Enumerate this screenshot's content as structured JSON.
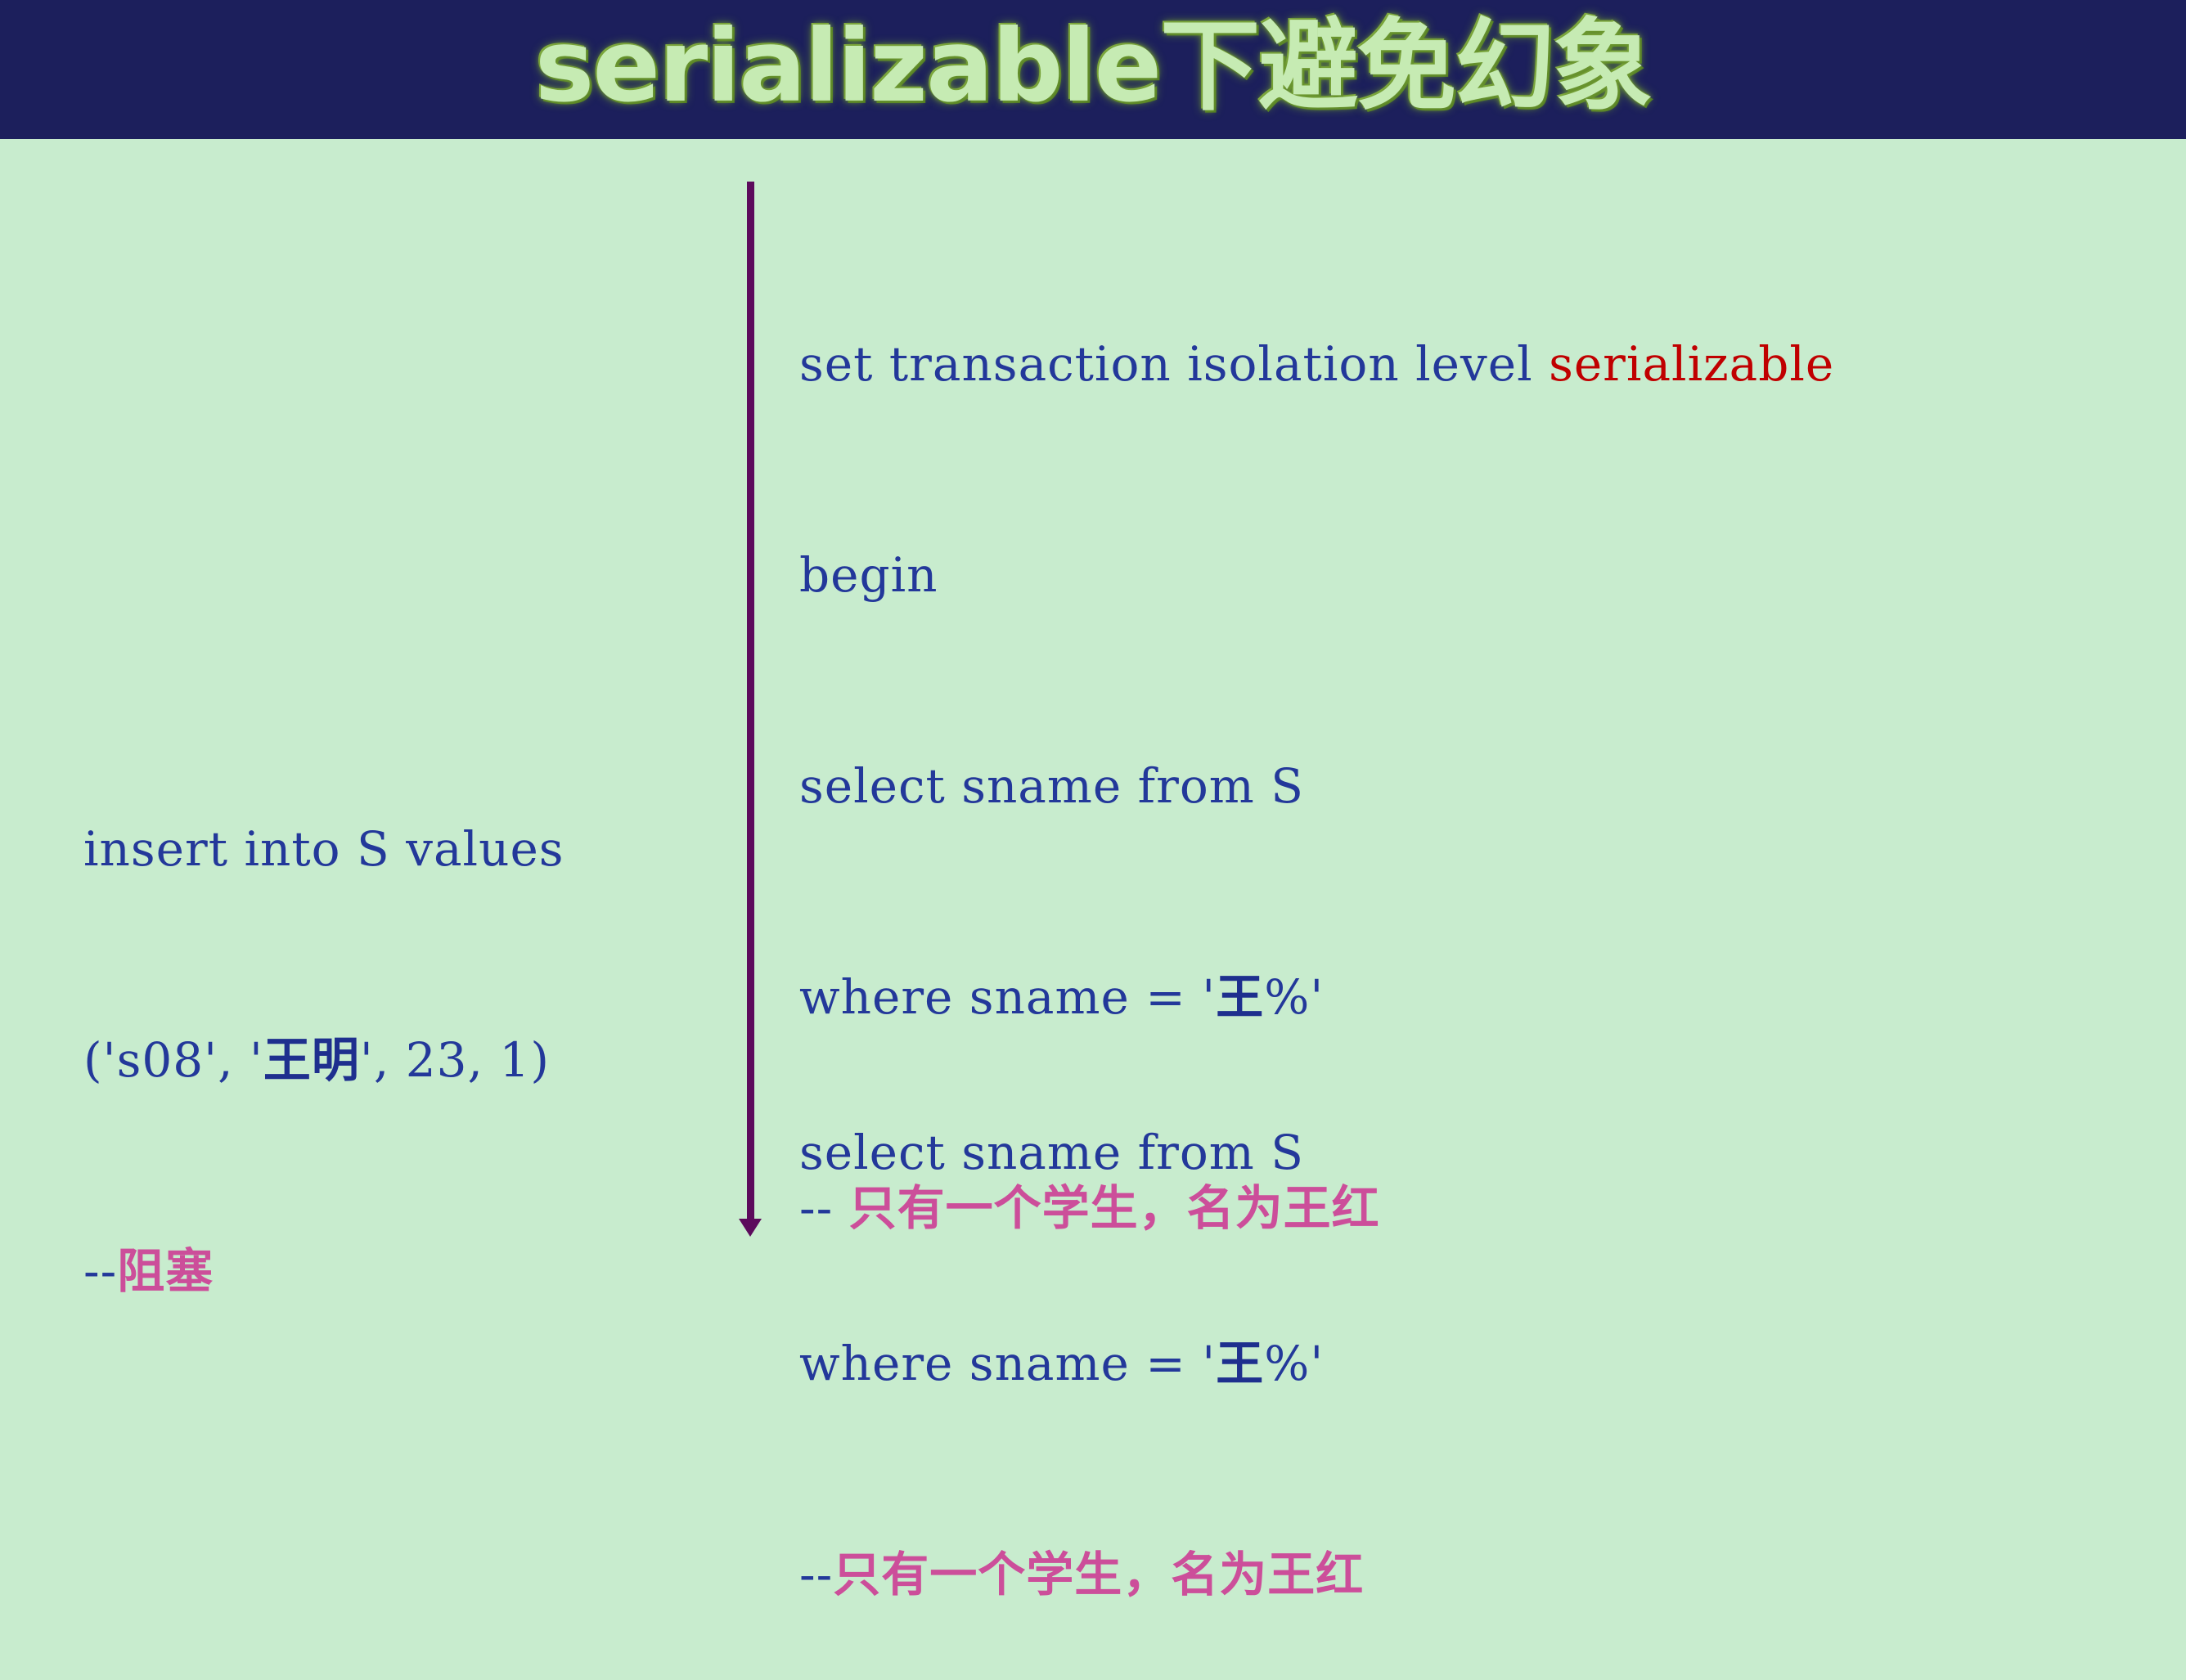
{
  "title": "serializable下避免幻象",
  "colors": {
    "header_bg": "#1c1f5c",
    "page_bg": "#c8ecce",
    "code_blue": "#23389a",
    "keyword_red": "#c00000",
    "comment_pink": "#cc4e9a",
    "timeline": "#5c0b5c"
  },
  "session_b_first": {
    "line1_prefix": "set transaction isolation level ",
    "line1_keyword": "serializable",
    "line2": "begin",
    "line3": "select sname from S",
    "line4_prefix": "where sname = '",
    "line4_cjk": "王",
    "line4_suffix": "%'",
    "line5_dash": "-- ",
    "line5_comment": "只有一个学生，名为王红"
  },
  "session_a": {
    "line1": "insert into S values",
    "line2_a": "('s08', '",
    "line2_cjk": "王明",
    "line2_b": "', 23, 1)",
    "line3_dash": "--",
    "line3_comment": "阻塞"
  },
  "session_b_second": {
    "line1": "select sname from S",
    "line2_prefix": "where sname = '",
    "line2_cjk": "王",
    "line2_suffix": "%'",
    "line3_dash": "--",
    "line3_comment": "只有一个学生，名为王红"
  }
}
